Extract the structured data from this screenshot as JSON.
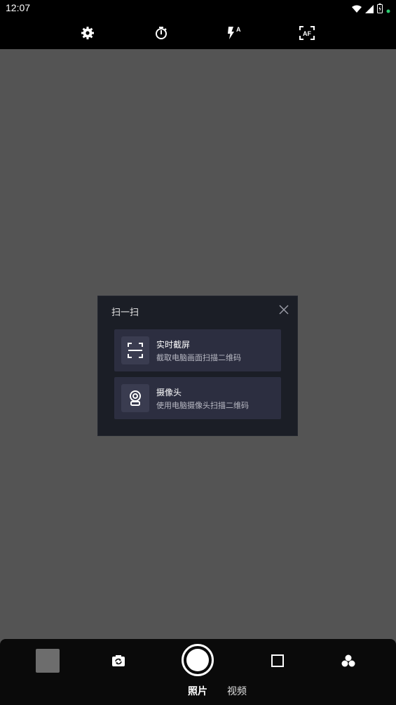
{
  "status_bar": {
    "time": "12:07",
    "icons": [
      "wifi-icon",
      "cell-signal-icon",
      "battery-icon",
      "notification-dot-icon"
    ]
  },
  "camera_toolbar": {
    "items": [
      "settings-icon",
      "timer-icon",
      "flash-auto-icon",
      "autofocus-icon"
    ]
  },
  "dialog": {
    "title": "扫一扫",
    "options": [
      {
        "title": "实时截屏",
        "subtitle": "截取电脑画面扫描二维码",
        "icon": "scan-frame-icon"
      },
      {
        "title": "摄像头",
        "subtitle": "使用电脑摄像头扫描二维码",
        "icon": "webcam-icon"
      }
    ]
  },
  "bottom_bar": {
    "modes": [
      "照片",
      "视频"
    ],
    "active_mode": "照片",
    "tools": [
      "switch-camera-icon",
      "aspect-ratio-icon",
      "filters-icon"
    ]
  },
  "colors": {
    "viewfinder": "#545454",
    "dialog_bg": "#1b1e26",
    "option_bg": "#2c2e40",
    "status_dot": "#2ecc71"
  }
}
